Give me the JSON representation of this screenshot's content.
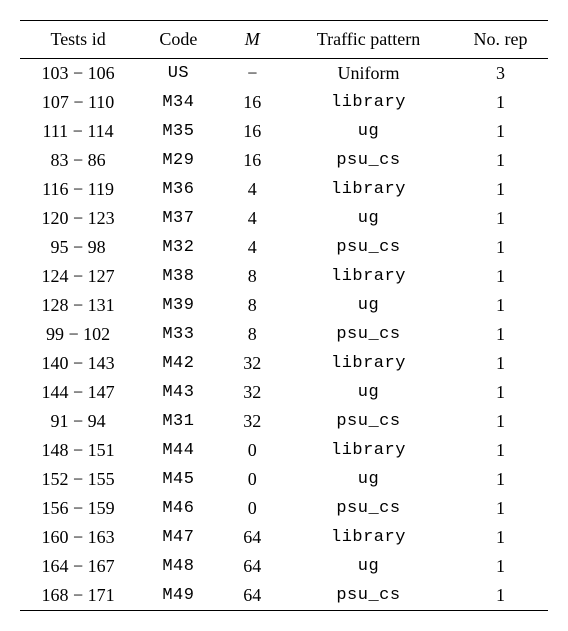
{
  "chart_data": {
    "type": "table",
    "headers": {
      "tests_id": "Tests id",
      "code": "Code",
      "m": "M",
      "traffic_pattern": "Traffic pattern",
      "no_rep": "No. rep"
    },
    "rows": [
      {
        "tests_id": "103 − 106",
        "code": "US",
        "m": "−",
        "traffic_pattern": "Uniform",
        "no_rep": "3",
        "pattern_style": "uniform"
      },
      {
        "tests_id": "107 − 110",
        "code": "M34",
        "m": "16",
        "traffic_pattern": "library",
        "no_rep": "1",
        "pattern_style": "mono"
      },
      {
        "tests_id": "111 − 114",
        "code": "M35",
        "m": "16",
        "traffic_pattern": "ug",
        "no_rep": "1",
        "pattern_style": "mono"
      },
      {
        "tests_id": "83 − 86",
        "code": "M29",
        "m": "16",
        "traffic_pattern": "psu_cs",
        "no_rep": "1",
        "pattern_style": "mono"
      },
      {
        "tests_id": "116 − 119",
        "code": "M36",
        "m": "4",
        "traffic_pattern": "library",
        "no_rep": "1",
        "pattern_style": "mono"
      },
      {
        "tests_id": "120 − 123",
        "code": "M37",
        "m": "4",
        "traffic_pattern": "ug",
        "no_rep": "1",
        "pattern_style": "mono"
      },
      {
        "tests_id": "95 − 98",
        "code": "M32",
        "m": "4",
        "traffic_pattern": "psu_cs",
        "no_rep": "1",
        "pattern_style": "mono"
      },
      {
        "tests_id": "124 − 127",
        "code": "M38",
        "m": "8",
        "traffic_pattern": "library",
        "no_rep": "1",
        "pattern_style": "mono"
      },
      {
        "tests_id": "128 − 131",
        "code": "M39",
        "m": "8",
        "traffic_pattern": "ug",
        "no_rep": "1",
        "pattern_style": "mono"
      },
      {
        "tests_id": "99 − 102",
        "code": "M33",
        "m": "8",
        "traffic_pattern": "psu_cs",
        "no_rep": "1",
        "pattern_style": "mono"
      },
      {
        "tests_id": "140 − 143",
        "code": "M42",
        "m": "32",
        "traffic_pattern": "library",
        "no_rep": "1",
        "pattern_style": "mono"
      },
      {
        "tests_id": "144 − 147",
        "code": "M43",
        "m": "32",
        "traffic_pattern": "ug",
        "no_rep": "1",
        "pattern_style": "mono"
      },
      {
        "tests_id": "91 − 94",
        "code": "M31",
        "m": "32",
        "traffic_pattern": "psu_cs",
        "no_rep": "1",
        "pattern_style": "mono"
      },
      {
        "tests_id": "148 − 151",
        "code": "M44",
        "m": "0",
        "traffic_pattern": "library",
        "no_rep": "1",
        "pattern_style": "mono"
      },
      {
        "tests_id": "152 − 155",
        "code": "M45",
        "m": "0",
        "traffic_pattern": "ug",
        "no_rep": "1",
        "pattern_style": "mono"
      },
      {
        "tests_id": "156 − 159",
        "code": "M46",
        "m": "0",
        "traffic_pattern": "psu_cs",
        "no_rep": "1",
        "pattern_style": "mono"
      },
      {
        "tests_id": "160 − 163",
        "code": "M47",
        "m": "64",
        "traffic_pattern": "library",
        "no_rep": "1",
        "pattern_style": "mono"
      },
      {
        "tests_id": "164 − 167",
        "code": "M48",
        "m": "64",
        "traffic_pattern": "ug",
        "no_rep": "1",
        "pattern_style": "mono"
      },
      {
        "tests_id": "168 − 171",
        "code": "M49",
        "m": "64",
        "traffic_pattern": "psu_cs",
        "no_rep": "1",
        "pattern_style": "mono"
      }
    ]
  }
}
